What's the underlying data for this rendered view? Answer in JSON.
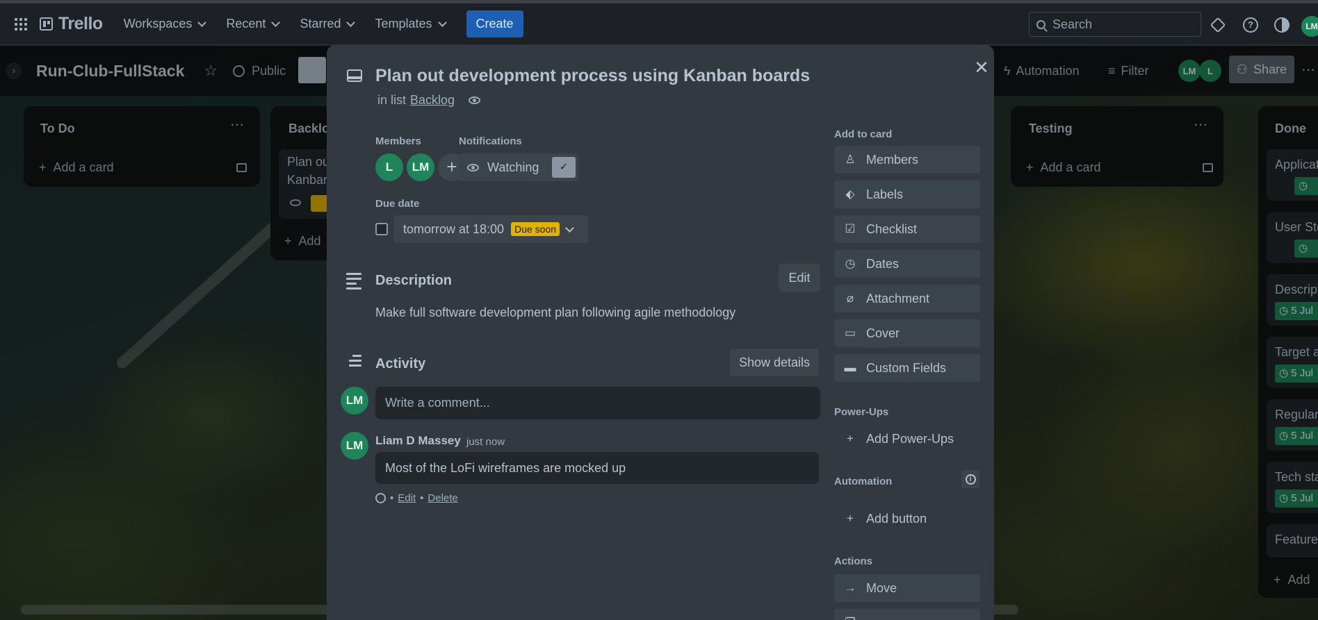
{
  "topbar": {
    "app_name": "Trello",
    "nav": [
      {
        "label": "Workspaces"
      },
      {
        "label": "Recent"
      },
      {
        "label": "Starred"
      },
      {
        "label": "Templates"
      }
    ],
    "create_label": "Create",
    "search_placeholder": "Search",
    "user_initials": "LM"
  },
  "board": {
    "title": "Run-Club-FullStack",
    "visibility": "Public",
    "automation_label": "Automation",
    "filter_label": "Filter",
    "member_initials": [
      "LM",
      "L"
    ],
    "share_label": "Share",
    "lists": [
      {
        "title": "To Do",
        "add_card": "Add a card"
      },
      {
        "title": "Backlo",
        "card_title_1": "Plan ou",
        "card_title_2": "Kanbar",
        "add_card": "Add"
      },
      {
        "title": "Testing",
        "add_card": "Add a card"
      },
      {
        "title": "Done",
        "cards": [
          "Applicat",
          "User Sto",
          "Descript",
          "Target a",
          "Regular",
          "Tech sta",
          "Features"
        ],
        "badge": "5 Jul",
        "add_card": "Add"
      }
    ]
  },
  "modal": {
    "title": "Plan out development process using Kanban boards",
    "in_list_prefix": "in list",
    "list_name": "Backlog",
    "members_label": "Members",
    "members": [
      "L",
      "LM"
    ],
    "notifications_label": "Notifications",
    "watching_label": "Watching",
    "due_date_label": "Due date",
    "due_value": "tomorrow at 18:00",
    "due_badge": "Due soon",
    "description_title": "Description",
    "edit_label": "Edit",
    "description_text": "Make full software development plan following agile methodology",
    "activity_title": "Activity",
    "show_details_label": "Show details",
    "comment_placeholder": "Write a comment...",
    "current_user": "LM",
    "comment": {
      "author": "Liam D Massey",
      "time": "just now",
      "text": "Most of the LoFi wireframes are mocked up",
      "edit": "Edit",
      "delete": "Delete",
      "sep": "•"
    },
    "sidebar": {
      "add_to_card_label": "Add to card",
      "add_items": [
        "Members",
        "Labels",
        "Checklist",
        "Dates",
        "Attachment",
        "Cover",
        "Custom Fields"
      ],
      "powerups_label": "Power-Ups",
      "add_powerups": "Add Power-Ups",
      "automation_label": "Automation",
      "add_button": "Add button",
      "actions_label": "Actions",
      "move_label": "Move"
    }
  },
  "colors": {
    "accent_green": "#1f845a",
    "due_soon": "#e2b203",
    "modal_bg": "#323940",
    "create_blue": "#1d5fb5"
  }
}
